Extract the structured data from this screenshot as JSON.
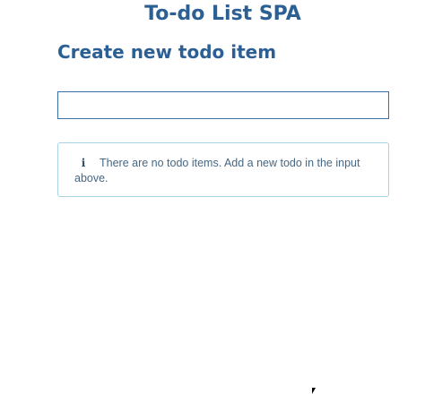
{
  "app": {
    "title": "To-do List SPA"
  },
  "form": {
    "heading": "Create new todo item",
    "input_value": "",
    "input_placeholder": ""
  },
  "empty_state": {
    "icon": "info-icon",
    "icon_glyph": "i",
    "message": "There are no todo items. Add a new todo in the input above."
  },
  "colors": {
    "heading": "#2c5f93",
    "input_border": "#3a6ea5",
    "info_border": "#a7d3e4",
    "info_text": "#466784"
  }
}
